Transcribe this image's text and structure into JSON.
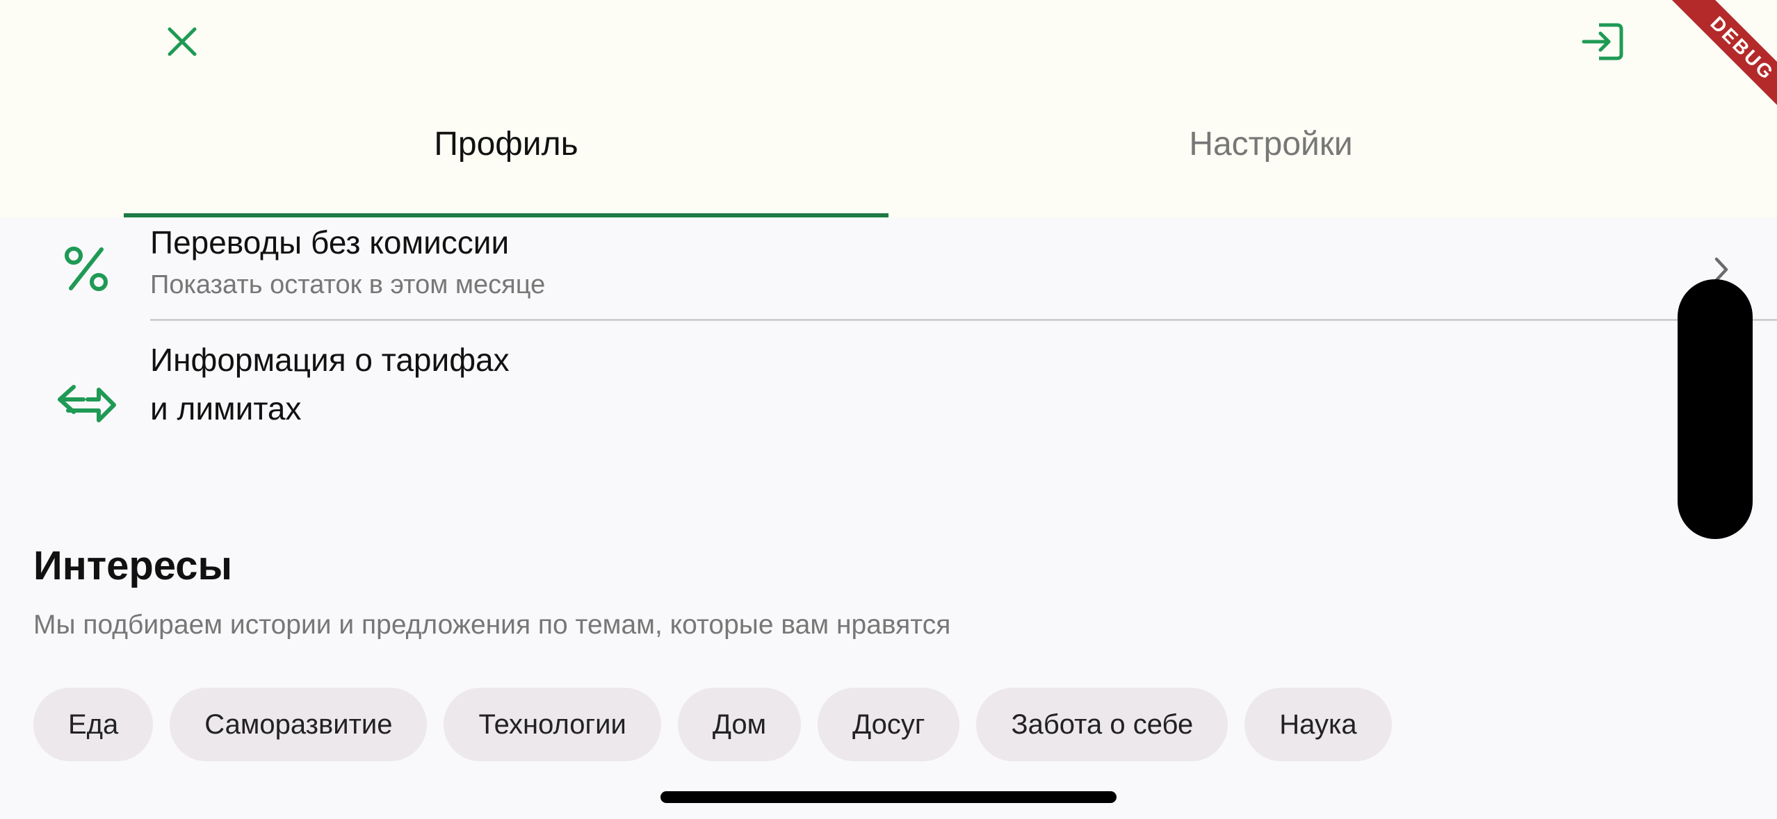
{
  "header": {
    "close_icon": "close-x-icon",
    "logout_icon": "logout-arrow-icon",
    "tabs": [
      {
        "label": "Профиль",
        "active": true
      },
      {
        "label": "Настройки",
        "active": false
      }
    ],
    "debug_badge": "DEBUG"
  },
  "rows": [
    {
      "icon": "percent-icon",
      "title": "Переводы без комиссии",
      "subtitle": "Показать остаток в этом месяце"
    },
    {
      "icon": "transfer-arrows-icon",
      "title_line1": "Информация о тарифах",
      "title_line2": "и лимитах"
    }
  ],
  "interests": {
    "title": "Интересы",
    "description": "Мы подбираем истории и предложения по темам, которые вам нравятся",
    "chips": [
      "Еда",
      "Саморазвитие",
      "Технологии",
      "Дом",
      "Досуг",
      "Забота о себе",
      "Наука"
    ]
  },
  "colors": {
    "accent": "#1F9A55",
    "tab_indicator": "#1F7A45",
    "header_bg": "#FDFDF5",
    "page_bg": "#F9F9FB",
    "chip_bg": "#ECE8EC",
    "debug_ribbon": "#B42A2A"
  }
}
